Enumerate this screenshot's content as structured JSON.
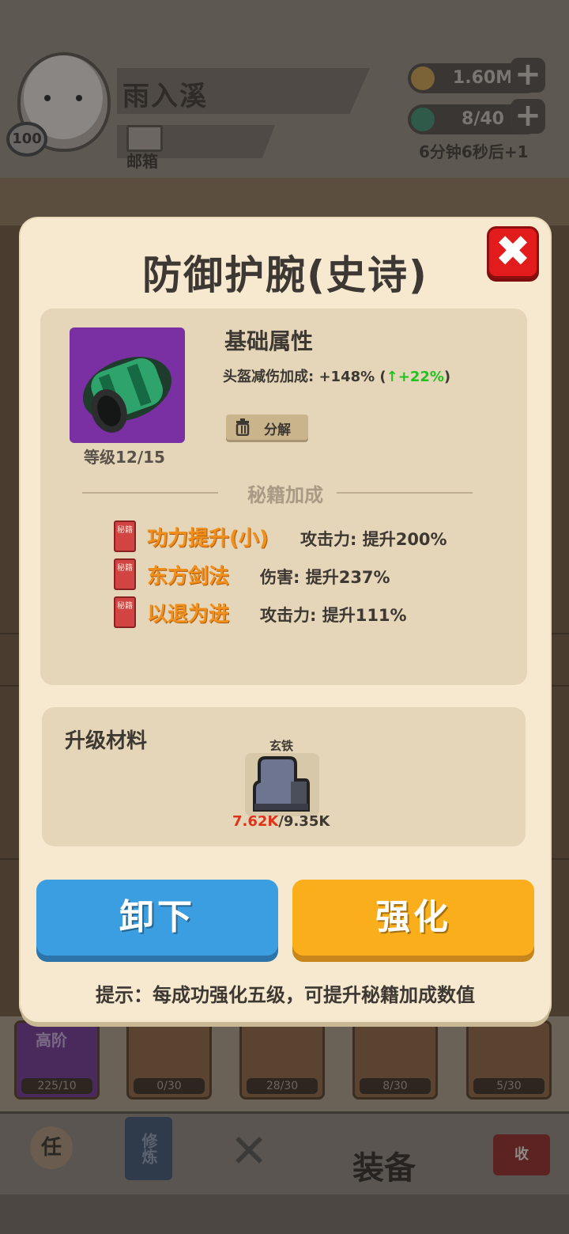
{
  "header": {
    "player_name": "雨入溪",
    "level": "100",
    "mail_label": "邮箱",
    "gold": "1.60M",
    "energy": "8/40",
    "regen_timer": "6分钟6秒后+1"
  },
  "background_cards": [
    {
      "label": "高阶",
      "count": "225/10"
    },
    {
      "label": "",
      "count": "0/30"
    },
    {
      "label": "",
      "count": "28/30"
    },
    {
      "label": "",
      "count": "8/30"
    },
    {
      "label": "",
      "count": "5/30"
    }
  ],
  "nav": {
    "task_label": "任",
    "train_label": "修炼",
    "equip_label": "装备",
    "collect_label": "收"
  },
  "modal": {
    "title": "防御护腕(史诗)",
    "close_label": "✖",
    "item_level": "等级12/15",
    "base_title": "基础属性",
    "base_stat_prefix": "头盔减伤加成: +148% (",
    "base_stat_up": "↑+22%",
    "base_stat_suffix": ")",
    "decompose_label": "分解",
    "secret_section": "秘籍加成",
    "secret_book_label": "秘籍",
    "skills": [
      {
        "name": "功力提升(小)",
        "desc": "攻击力: 提升200%"
      },
      {
        "name": "东方剑法",
        "desc": "伤害: 提升237%"
      },
      {
        "name": "以退为进",
        "desc": "攻击力: 提升111%"
      }
    ],
    "materials_title": "升级材料",
    "material_name": "玄铁",
    "material_have": "7.62K",
    "material_need": "/9.35K",
    "unequip_label": "卸下",
    "upgrade_label": "强化",
    "tip": "提示：每成功强化五级，可提升秘籍加成数值"
  },
  "colors": {
    "modal_bg": "#f6e9cf",
    "panel_bg": "#e5d6b9",
    "item_rarity_epic": "#7a2fa3",
    "skill_name": "#f08f1a",
    "stat_up": "#21c11f",
    "close_red": "#e21c1c",
    "unequip_blue": "#3b9ee1",
    "upgrade_orange": "#fbae1c"
  }
}
